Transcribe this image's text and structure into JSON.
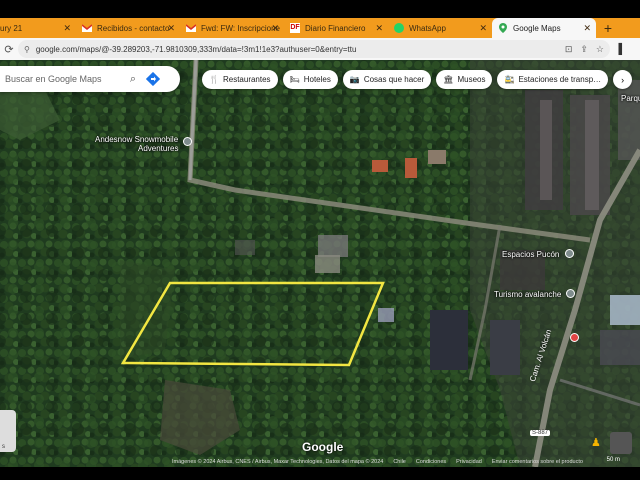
{
  "tabs": [
    {
      "title": "ury 21",
      "active": false
    },
    {
      "title": "Recibidos - contacto",
      "active": false,
      "icon": "gmail-icon"
    },
    {
      "title": "Fwd: FW: Inscripcione",
      "active": false,
      "icon": "gmail-icon"
    },
    {
      "title": "Diario Financiero",
      "active": false,
      "icon": "df-icon"
    },
    {
      "title": "WhatsApp",
      "active": false,
      "icon": "whatsapp-icon"
    },
    {
      "title": "Google Maps",
      "active": true,
      "icon": "maps-icon"
    }
  ],
  "address": {
    "url": "google.com/maps/@-39.289203,-71.9810309,333m/data=!3m1!1e3?authuser=0&entry=ttu"
  },
  "search": {
    "placeholder": "Buscar en Google Maps"
  },
  "chips": [
    {
      "label": "Restaurantes",
      "icon": "fork-knife-icon"
    },
    {
      "label": "Hoteles",
      "icon": "bed-icon"
    },
    {
      "label": "Cosas que hacer",
      "icon": "camera-icon"
    },
    {
      "label": "Museos",
      "icon": "museum-icon"
    },
    {
      "label": "Estaciones de transp…",
      "icon": "transit-icon"
    }
  ],
  "labels": {
    "andesnow": "Andesnow Snowmobile",
    "andesnow2": "Adventures",
    "espacios": "Espacios Pucón",
    "turismo": "Turismo avalanche",
    "parque": "Parque S",
    "road_volcan": "Cam. Al Volcán",
    "route": "S-887"
  },
  "footer": {
    "logo": "Google",
    "imagery": "Imágenes © 2024 Airbus, CNES / Airbus, Maxar Technologies, Datos del mapa © 2024",
    "country": "Chile",
    "terms": "Condiciones",
    "privacy": "Privacidad",
    "feedback": "Enviar comentarios sobre el producto",
    "scale": "50 m"
  },
  "layers_label": "s",
  "colors": {
    "tab_strip": "#f29b1d",
    "parcel_outline": "#f2e642",
    "forest": "#1e3a1e"
  }
}
